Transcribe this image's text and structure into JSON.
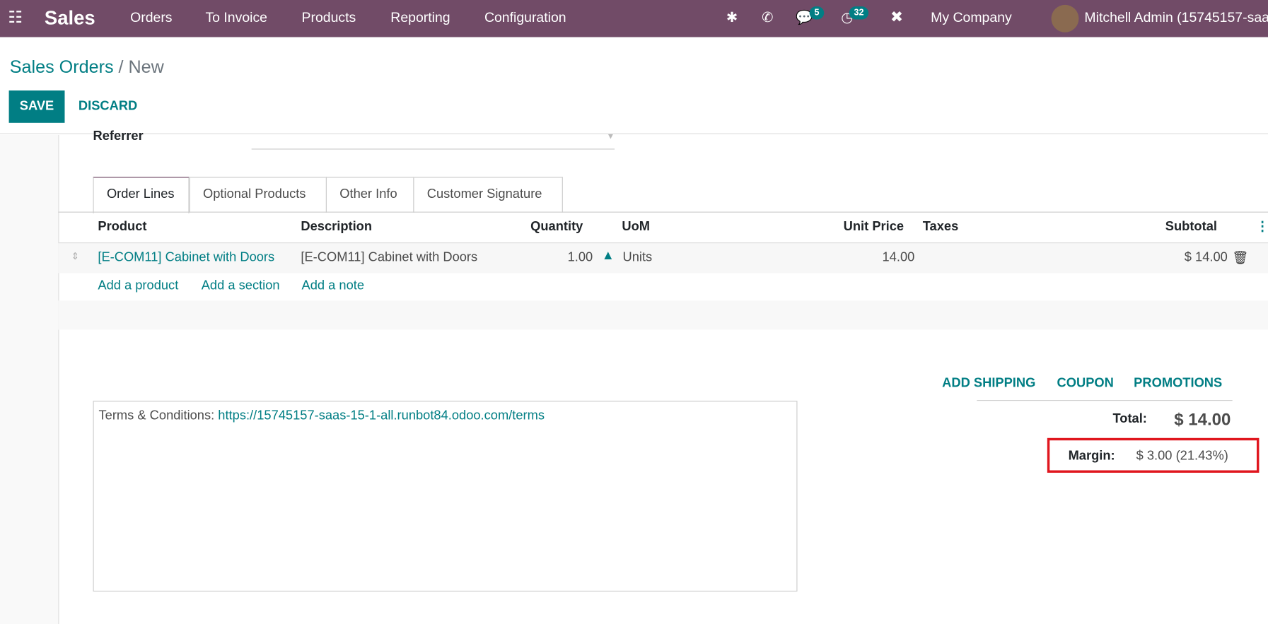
{
  "navbar": {
    "app": "Sales",
    "menu": [
      "Orders",
      "To Invoice",
      "Products",
      "Reporting",
      "Configuration"
    ],
    "messages_count": "5",
    "activities_count": "32",
    "company": "My Company",
    "user": "Mitchell Admin (15745157-saas",
    "color": "#714B67"
  },
  "breadcrumb": {
    "parent": "Sales Orders",
    "sep": " / ",
    "current": "New"
  },
  "buttons": {
    "save": "SAVE",
    "discard": "DISCARD"
  },
  "form": {
    "referrer_label": "Referrer",
    "referrer_value": ""
  },
  "tabs": [
    "Order Lines",
    "Optional Products",
    "Other Info",
    "Customer Signature"
  ],
  "table": {
    "headers": {
      "product": "Product",
      "description": "Description",
      "quantity": "Quantity",
      "uom": "UoM",
      "unit_price": "Unit Price",
      "taxes": "Taxes",
      "subtotal": "Subtotal"
    },
    "rows": [
      {
        "product": "[E-COM11] Cabinet with Doors",
        "description": "[E-COM11] Cabinet with Doors",
        "quantity": "1.00",
        "uom": "Units",
        "unit_price": "14.00",
        "taxes": "",
        "subtotal": "$ 14.00"
      }
    ],
    "add_product": "Add a product",
    "add_section": "Add a section",
    "add_note": "Add a note"
  },
  "actions": {
    "add_shipping": "ADD SHIPPING",
    "coupon": "COUPON",
    "promotions": "PROMOTIONS"
  },
  "terms": {
    "label": "Terms & Conditions: ",
    "url": "https://15745157-saas-15-1-all.runbot84.odoo.com/terms"
  },
  "totals": {
    "total_label": "Total:",
    "total": "$ 14.00",
    "margin_label": "Margin:",
    "margin": "$ 3.00 (21.43%)",
    "highlight_color": "#e0161e"
  },
  "accent": "#017E84"
}
